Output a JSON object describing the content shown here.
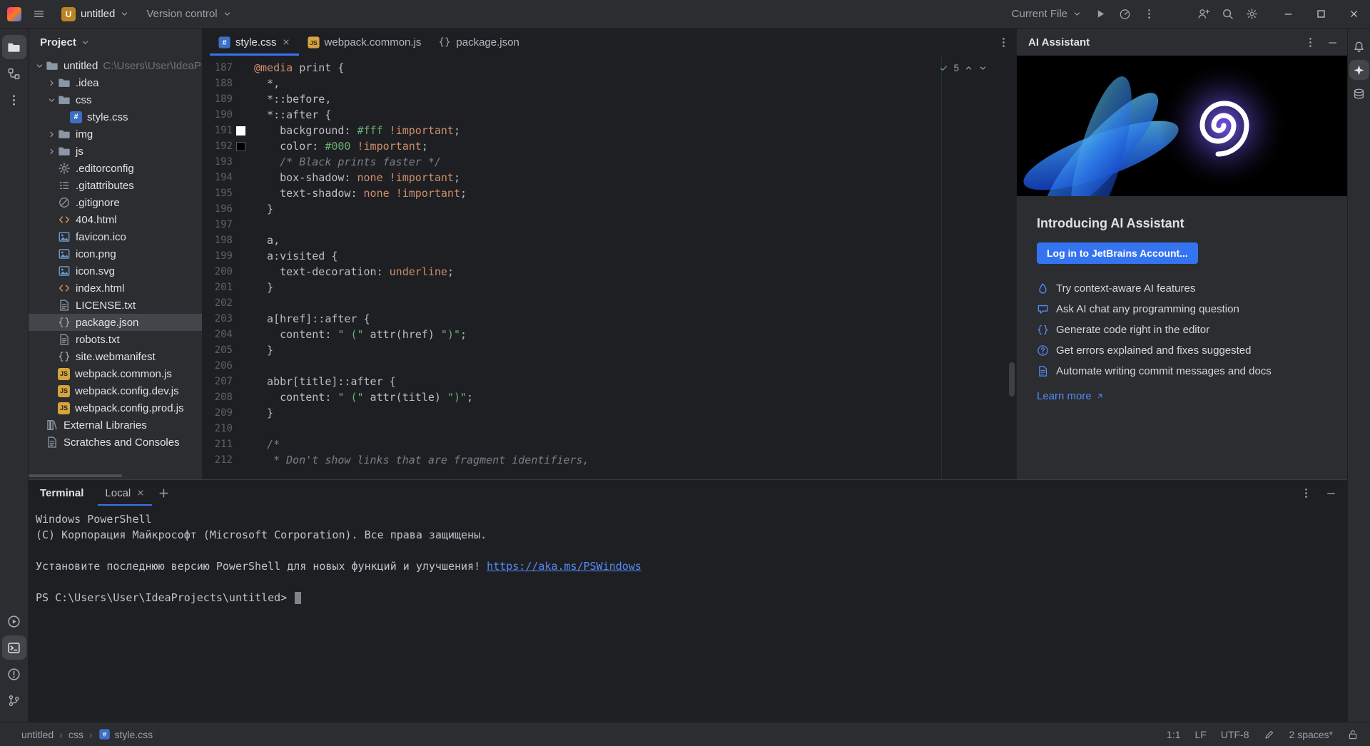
{
  "colors": {
    "accent": "#3574f0"
  },
  "titlebar": {
    "project_badge": "U",
    "project_name": "untitled",
    "menu_version_control": "Version control",
    "run_config": "Current File"
  },
  "activity_left": {
    "top": [
      {
        "icon": "folder",
        "name": "project",
        "active": true
      },
      {
        "icon": "structure",
        "name": "commit"
      },
      {
        "icon": "kebab",
        "name": "more-tool-windows"
      }
    ],
    "bottom": [
      {
        "icon": "runcircle",
        "name": "run"
      },
      {
        "icon": "terminal",
        "name": "terminal",
        "active": true
      },
      {
        "icon": "problems",
        "name": "problems"
      },
      {
        "icon": "gitbranch",
        "name": "version-control"
      }
    ]
  },
  "activity_right": [
    {
      "icon": "bell",
      "name": "notifications"
    },
    {
      "icon": "ai",
      "name": "ai-assistant",
      "active": true
    },
    {
      "icon": "database",
      "name": "database"
    }
  ],
  "project_panel": {
    "title": "Project",
    "tree": [
      {
        "label": "untitled",
        "path": "C:\\Users\\User\\IdeaPr",
        "icon": "folder",
        "indent": 0,
        "chevron": "down"
      },
      {
        "label": ".idea",
        "icon": "folder",
        "indent": 1,
        "chevron": "right"
      },
      {
        "label": "css",
        "icon": "folder",
        "indent": 1,
        "chevron": "down"
      },
      {
        "label": "style.css",
        "icon": "css",
        "indent": 2
      },
      {
        "label": "img",
        "icon": "folder",
        "indent": 1,
        "chevron": "right"
      },
      {
        "label": "js",
        "icon": "folder",
        "indent": 1,
        "chevron": "right"
      },
      {
        "label": ".editorconfig",
        "icon": "gearfile",
        "indent": 1
      },
      {
        "label": ".gitattributes",
        "icon": "listfile",
        "indent": 1
      },
      {
        "label": ".gitignore",
        "icon": "ignore",
        "indent": 1
      },
      {
        "label": "404.html",
        "icon": "code",
        "indent": 1
      },
      {
        "label": "favicon.ico",
        "icon": "image",
        "indent": 1
      },
      {
        "label": "icon.png",
        "icon": "image",
        "indent": 1
      },
      {
        "label": "icon.svg",
        "icon": "image",
        "indent": 1
      },
      {
        "label": "index.html",
        "icon": "code",
        "indent": 1
      },
      {
        "label": "LICENSE.txt",
        "icon": "text",
        "indent": 1
      },
      {
        "label": "package.json",
        "icon": "json",
        "indent": 1,
        "selected": true
      },
      {
        "label": "robots.txt",
        "icon": "text",
        "indent": 1
      },
      {
        "label": "site.webmanifest",
        "icon": "json",
        "indent": 1
      },
      {
        "label": "webpack.common.js",
        "icon": "js",
        "indent": 1
      },
      {
        "label": "webpack.config.dev.js",
        "icon": "js",
        "indent": 1
      },
      {
        "label": "webpack.config.prod.js",
        "icon": "js",
        "indent": 1
      },
      {
        "label": "External Libraries",
        "icon": "library",
        "indent": 0
      },
      {
        "label": "Scratches and Consoles",
        "icon": "scratch",
        "indent": 0
      }
    ]
  },
  "editor": {
    "tabs": [
      {
        "label": "style.css",
        "icon": "css",
        "active": true,
        "close": true
      },
      {
        "label": "webpack.common.js",
        "icon": "js"
      },
      {
        "label": "package.json",
        "icon": "json"
      }
    ],
    "inspections": "5",
    "code": [
      {
        "n": 187,
        "t": [
          [
            "@media",
            "at"
          ],
          [
            " print {",
            "pl"
          ]
        ]
      },
      {
        "n": 188,
        "t": [
          [
            "  *,",
            "pl"
          ]
        ]
      },
      {
        "n": 189,
        "t": [
          [
            "  *::before,",
            "pl"
          ]
        ]
      },
      {
        "n": 190,
        "t": [
          [
            "  *::after {",
            "pl"
          ]
        ]
      },
      {
        "n": 191,
        "swatch": "#ffffff",
        "t": [
          [
            "    background: ",
            "pl"
          ],
          [
            "#fff",
            "str"
          ],
          [
            " ",
            "pl"
          ],
          [
            "!important",
            "kw"
          ],
          [
            ";",
            "pl"
          ]
        ]
      },
      {
        "n": 192,
        "swatch": "#000000",
        "t": [
          [
            "    color: ",
            "pl"
          ],
          [
            "#000",
            "str"
          ],
          [
            " ",
            "pl"
          ],
          [
            "!important",
            "kw"
          ],
          [
            ";",
            "pl"
          ]
        ]
      },
      {
        "n": 193,
        "t": [
          [
            "    ",
            "pl"
          ],
          [
            "/* Black prints faster */",
            "cm"
          ]
        ]
      },
      {
        "n": 194,
        "t": [
          [
            "    box-shadow: ",
            "pl"
          ],
          [
            "none",
            "kw"
          ],
          [
            " ",
            "pl"
          ],
          [
            "!important",
            "kw"
          ],
          [
            ";",
            "pl"
          ]
        ]
      },
      {
        "n": 195,
        "t": [
          [
            "    text-shadow: ",
            "pl"
          ],
          [
            "none",
            "kw"
          ],
          [
            " ",
            "pl"
          ],
          [
            "!important",
            "kw"
          ],
          [
            ";",
            "pl"
          ]
        ]
      },
      {
        "n": 196,
        "t": [
          [
            "  }",
            "pl"
          ]
        ]
      },
      {
        "n": 197,
        "t": []
      },
      {
        "n": 198,
        "t": [
          [
            "  a,",
            "pl"
          ]
        ]
      },
      {
        "n": 199,
        "t": [
          [
            "  a:visited {",
            "pl"
          ]
        ]
      },
      {
        "n": 200,
        "t": [
          [
            "    text-decoration: ",
            "pl"
          ],
          [
            "underline",
            "kw"
          ],
          [
            ";",
            "pl"
          ]
        ]
      },
      {
        "n": 201,
        "t": [
          [
            "  }",
            "pl"
          ]
        ]
      },
      {
        "n": 202,
        "t": []
      },
      {
        "n": 203,
        "t": [
          [
            "  a[href]::after {",
            "pl"
          ]
        ]
      },
      {
        "n": 204,
        "t": [
          [
            "    content: ",
            "pl"
          ],
          [
            "\" (\"",
            "str"
          ],
          [
            " attr(href) ",
            "pl"
          ],
          [
            "\")\"",
            "str"
          ],
          [
            ";",
            "pl"
          ]
        ]
      },
      {
        "n": 205,
        "t": [
          [
            "  }",
            "pl"
          ]
        ]
      },
      {
        "n": 206,
        "t": []
      },
      {
        "n": 207,
        "t": [
          [
            "  abbr[title]::after {",
            "pl"
          ]
        ]
      },
      {
        "n": 208,
        "t": [
          [
            "    content: ",
            "pl"
          ],
          [
            "\" (\"",
            "str"
          ],
          [
            " attr(title) ",
            "pl"
          ],
          [
            "\")\"",
            "str"
          ],
          [
            ";",
            "pl"
          ]
        ]
      },
      {
        "n": 209,
        "t": [
          [
            "  }",
            "pl"
          ]
        ]
      },
      {
        "n": 210,
        "t": []
      },
      {
        "n": 211,
        "t": [
          [
            "  /*",
            "cm"
          ]
        ]
      },
      {
        "n": 212,
        "t": [
          [
            "   * Don't show links that are fragment identifiers,",
            "cm"
          ]
        ]
      }
    ]
  },
  "ai": {
    "title": "AI Assistant",
    "heading": "Introducing AI Assistant",
    "login_button": "Log in to JetBrains Account...",
    "features": [
      {
        "icon": "drop",
        "text": "Try context-aware AI features"
      },
      {
        "icon": "chat",
        "text": "Ask AI chat any programming question"
      },
      {
        "icon": "braces",
        "text": "Generate code right in the editor"
      },
      {
        "icon": "help",
        "text": "Get errors explained and fixes suggested"
      },
      {
        "icon": "doc",
        "text": "Automate writing commit messages and docs"
      }
    ],
    "learn_more": "Learn more"
  },
  "terminal": {
    "title": "Terminal",
    "tab": "Local",
    "lines": [
      {
        "text": "Windows PowerShell"
      },
      {
        "text": "(C) Корпорация Майкрософт (Microsoft Corporation). Все права защищены."
      },
      {
        "text": ""
      },
      {
        "prefix": "Установите последнюю версию PowerShell для новых функций и улучшения! ",
        "link": "https://aka.ms/PSWindows"
      },
      {
        "text": ""
      },
      {
        "prompt": "PS C:\\Users\\User\\IdeaProjects\\untitled> "
      }
    ]
  },
  "statusbar": {
    "breadcrumbs": [
      {
        "label": "untitled"
      },
      {
        "label": "css"
      },
      {
        "label": "style.css",
        "icon": "css"
      }
    ],
    "right": [
      {
        "label": "1:1",
        "name": "caret-position"
      },
      {
        "label": "LF",
        "name": "line-ending"
      },
      {
        "label": "UTF-8",
        "name": "file-encoding"
      },
      {
        "icon": "pencil",
        "name": "edit-mode"
      },
      {
        "label": "2 spaces*",
        "name": "indentation"
      },
      {
        "icon": "unlock",
        "name": "read-lock"
      }
    ]
  }
}
